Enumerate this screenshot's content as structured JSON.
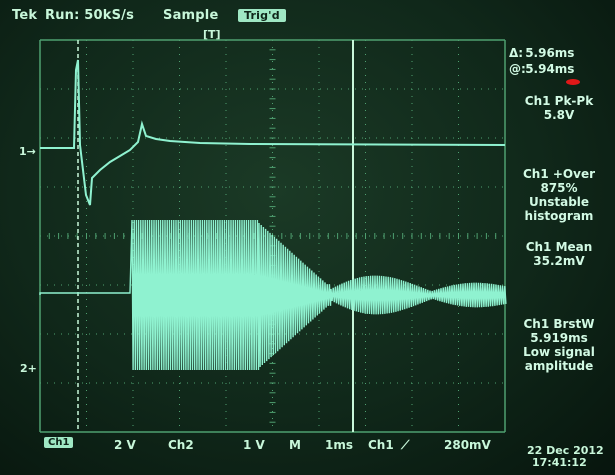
{
  "top_bar": {
    "brand": "Tek",
    "run_status": "Run: 50kS/s",
    "acq_mode": "Sample",
    "trigger_badge": "Trig'd",
    "trigger_pos_marker": "[T]"
  },
  "cursor": {
    "a_label": "Δ:",
    "a_value": "5.96ms",
    "b_label": "@:",
    "b_value": "5.94ms"
  },
  "measurements": [
    {
      "line1": "Ch1 Pk-Pk",
      "line2": "5.8V",
      "line3": "",
      "line4": ""
    },
    {
      "line1": "Ch1 +Over",
      "line2": "875%",
      "line3": "Unstable",
      "line4": "histogram"
    },
    {
      "line1": "Ch1 Mean",
      "line2": "35.2mV",
      "line3": "",
      "line4": ""
    },
    {
      "line1": "Ch1 BrstW",
      "line2": "5.919ms",
      "line3": "Low signal",
      "line4": "amplitude"
    }
  ],
  "channel_markers": {
    "ch1": "1→",
    "ch2": "2+"
  },
  "bottom_bar": {
    "ch1_badge": "Ch1",
    "ch1_vdiv": "2 V",
    "ch2": "Ch2",
    "ch2_vdiv": "1 V",
    "timebase_label": "M",
    "timebase": "1ms",
    "trigger_source": "Ch1",
    "trigger_slope": "⟋",
    "trigger_level": "280mV",
    "date": "22 Dec 2012",
    "time": "17:41:12"
  },
  "colors": {
    "trace": "#8ff2d0",
    "graticule": "#4fa070",
    "text": "#c8f7da",
    "cursor_marker": "#e01818"
  }
}
